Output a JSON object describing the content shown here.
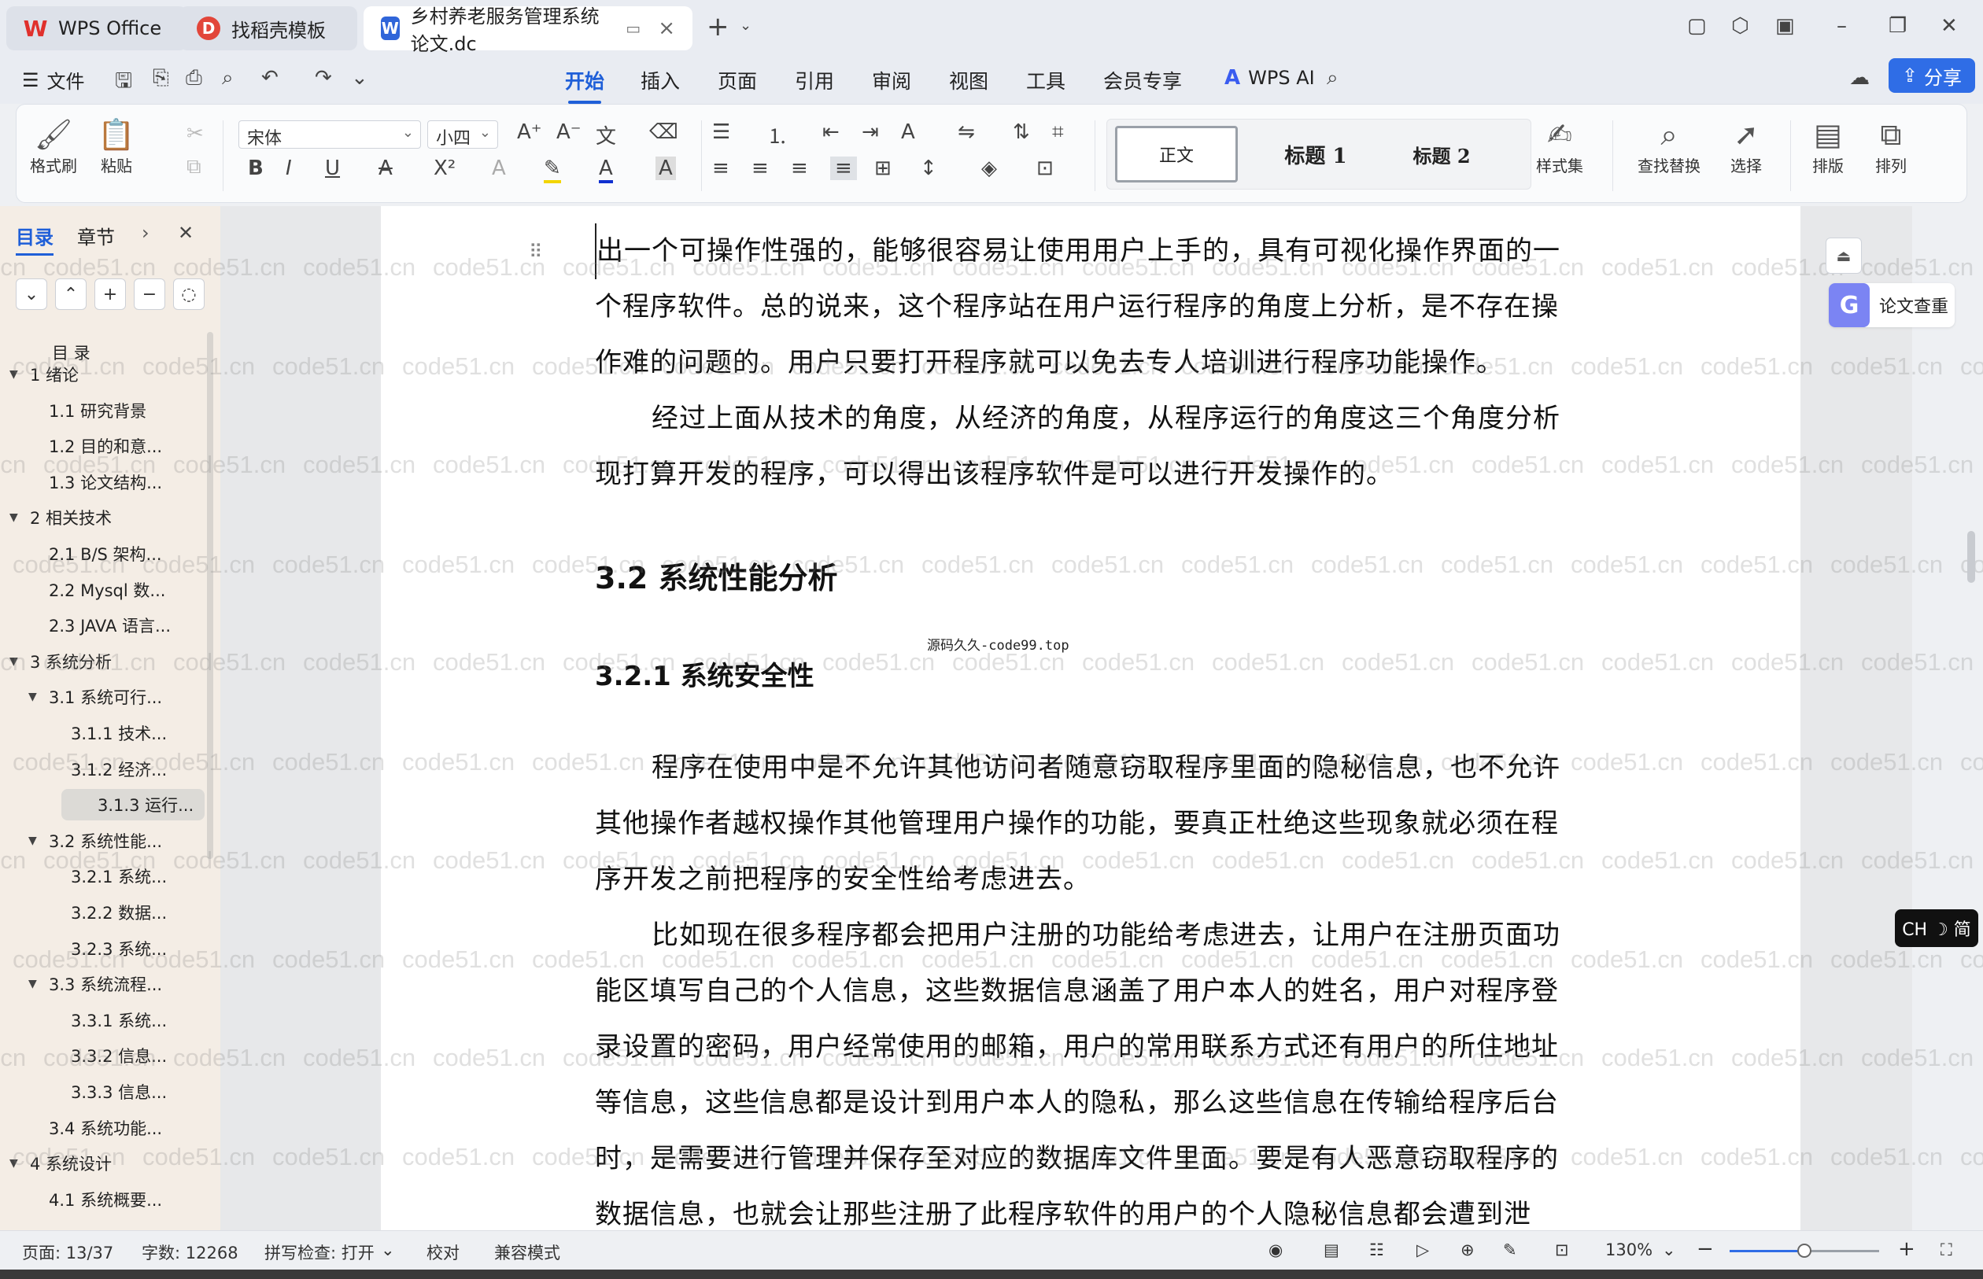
{
  "tabs": {
    "wps": "WPS Office",
    "template": "找稻壳模板",
    "doc": "乡村养老服务管理系统论文.dc"
  },
  "menu": {
    "file": "文件",
    "tabs": [
      "开始",
      "插入",
      "页面",
      "引用",
      "审阅",
      "视图",
      "工具",
      "会员专享"
    ],
    "active_tab": "开始",
    "wps_ai": "WPS AI",
    "share": "分享"
  },
  "ribbon": {
    "format_painter": "格式刷",
    "paste": "粘贴",
    "font_name": "宋体",
    "font_size": "小四",
    "styles": {
      "normal": "正文",
      "h1": "标题 1",
      "h2": "标题 2"
    },
    "style_set": "样式集",
    "find_replace": "查找替换",
    "select": "选择",
    "layout": "排版",
    "arrange": "排列"
  },
  "nav": {
    "tab_toc": "目录",
    "tab_chapter": "章节",
    "toc_title": "目 录",
    "items": [
      {
        "label": "1  绪论",
        "level": 1,
        "expanded": true
      },
      {
        "label": "1.1  研究背景",
        "level": 2
      },
      {
        "label": "1.2 目的和意...",
        "level": 2
      },
      {
        "label": "1.3  论文结构...",
        "level": 2
      },
      {
        "label": "2  相关技术",
        "level": 1,
        "expanded": true
      },
      {
        "label": "2.1 B/S 架构...",
        "level": 2
      },
      {
        "label": "2.2 Mysql 数...",
        "level": 2
      },
      {
        "label": "2.3 JAVA 语言...",
        "level": 2
      },
      {
        "label": "3  系统分析",
        "level": 1,
        "expanded": true
      },
      {
        "label": "3.1 系统可行...",
        "level": 2,
        "expanded": true
      },
      {
        "label": "3.1.1  技术...",
        "level": 3
      },
      {
        "label": "3.1.2  经济...",
        "level": 3
      },
      {
        "label": "3.1.3  运行...",
        "level": 3,
        "selected": true
      },
      {
        "label": "3.2 系统性能...",
        "level": 2,
        "expanded": true
      },
      {
        "label": "3.2.1  系统...",
        "level": 3
      },
      {
        "label": "3.2.2  数据...",
        "level": 3
      },
      {
        "label": "3.2.3 系统...",
        "level": 3
      },
      {
        "label": "3.3 系统流程...",
        "level": 2,
        "expanded": true
      },
      {
        "label": "3.3.1  系统...",
        "level": 3
      },
      {
        "label": "3.3.2 信息...",
        "level": 3
      },
      {
        "label": "3.3.3 信息...",
        "level": 3
      },
      {
        "label": "3.4 系统功能...",
        "level": 2
      },
      {
        "label": "4  系统设计",
        "level": 1,
        "expanded": true
      },
      {
        "label": "4.1 系统概要...",
        "level": 2
      }
    ]
  },
  "document": {
    "para1": [
      "出一个可操作性强的，能够很容易让使用用户上手的，具有可视化操作界面的一",
      "个程序软件。总的说来，这个程序站在用户运行程序的角度上分析，是不存在操",
      "作难的问题的。用户只要打开程序就可以免去专人培训进行程序功能操作。"
    ],
    "para2": [
      "经过上面从技术的角度，从经济的角度，从程序运行的角度这三个角度分析",
      "现打算开发的程序，可以得出该程序软件是可以进行开发操作的。"
    ],
    "heading_32": "3.2 系统性能分析",
    "stamp": "源码久久-code99.top",
    "heading_321": "3.2.1  系统安全性",
    "para3": [
      "程序在使用中是不允许其他访问者随意窃取程序里面的隐秘信息，也不允许",
      "其他操作者越权操作其他管理用户操作的功能，要真正杜绝这些现象就必须在程",
      "序开发之前把程序的安全性给考虑进去。"
    ],
    "para4": [
      "比如现在很多程序都会把用户注册的功能给考虑进去，让用户在注册页面功",
      "能区填写自己的个人信息，这些数据信息涵盖了用户本人的姓名，用户对程序登",
      "录设置的密码，用户经常使用的邮箱，用户的常用联系方式还有用户的所住地址",
      "等信息，这些信息都是设计到用户本人的隐私，那么这些信息在传输给程序后台",
      "时，是需要进行管理并保存至对应的数据库文件里面。要是有人恶意窃取程序的",
      "数据信息，也就会让那些注册了此程序软件的用户的个人隐秘信息都会遭到泄"
    ],
    "watermark": "code51.cn"
  },
  "side": {
    "paper_check": "论文查重",
    "ime": "CH ☽ 简"
  },
  "status": {
    "page": "页面: 13/37",
    "words": "字数: 12268",
    "spell": "拼写检查: 打开",
    "proof": "校对",
    "compat": "兼容模式",
    "zoom": "130%",
    "zoom_level": 0.5
  }
}
